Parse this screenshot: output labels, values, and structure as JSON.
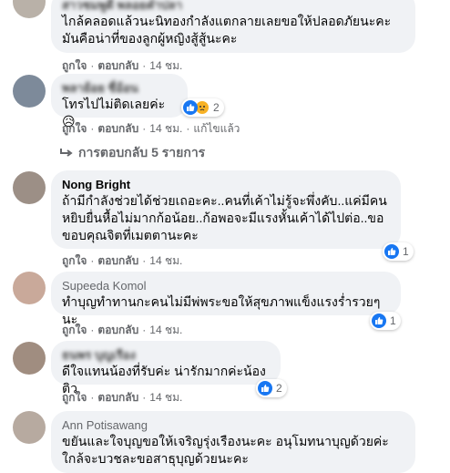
{
  "comments": [
    {
      "author": "สาวชมพูดี พลอยคำปลา",
      "text": "ไกล้คลอดแล้วนะนิทองกำลังแตกลายเลยขอให้ปลอดภัยนะคะ\nมันคือน่าที่ของลูกผู้หญิงสู้สู้นะคะ",
      "like": "ถูกใจ",
      "reply": "ตอบกลับ",
      "time": "14 ชม."
    },
    {
      "author": "พลาย้อย ชื่อ้อน",
      "text": "โทรไปไม่ติดเลยค่ะ😥",
      "reactions_count": "2",
      "like": "ถูกใจ",
      "reply": "ตอบกลับ",
      "time": "14 ชม.",
      "edited": "แก้ไขแล้ว",
      "replies_link": "การตอบกลับ 5 รายการ"
    },
    {
      "author": "Nong Bright",
      "text": "ถ้ามีกำลังช่วยได้ช่วยเถอะคะ..คนที่เค้าไม่รู้จะพึ่งคับ..แค่มีคน\nหยิบยื่นหื้อไม่มากก้อน้อย..ก้อพอจะมีแรงหั้นเค้าได้ไปต่อ..ขอ\nขอบคุณจิตที่เมตตานะคะ",
      "reactions_count": "1",
      "like": "ถูกใจ",
      "reply": "ตอบกลับ",
      "time": "14 ชม."
    },
    {
      "author": "Supeeda Komol",
      "text": "ทำบุญทำทานกะคนไม่มีพ่พระขอให้สุขภาพแข็งแรงร่ำรวยๆนะ",
      "reactions_count": "1",
      "like": "ถูกใจ",
      "reply": "ตอบกลับ",
      "time": "14 ชม."
    },
    {
      "author": "ธนพร บุญเรือง",
      "text": "ดีใจแทนน้องที่รับค่ะ น่ารักมากค่ะน้องติว",
      "reactions_count": "2",
      "like": "ถูกใจ",
      "reply": "ตอบกลับ",
      "time": "14 ชม."
    },
    {
      "author": "Ann Potisawang",
      "text": "ขยันและใจบุญขอให้เจริญรุ่งเรืองนะคะ อนุโมทนาบุญด้วยค่ะ\nใกล้จะบวชละขอสาธุบุญด้วยนะคะ"
    }
  ],
  "colors": {
    "bubble": "#f0f2f5",
    "like_blue": "#1877f2",
    "meta_gray": "#65676b"
  },
  "icons": {
    "like": "thumbs-up-icon",
    "sad": "sad-emoji-icon",
    "reply_arrow": "reply-arrow-icon"
  }
}
